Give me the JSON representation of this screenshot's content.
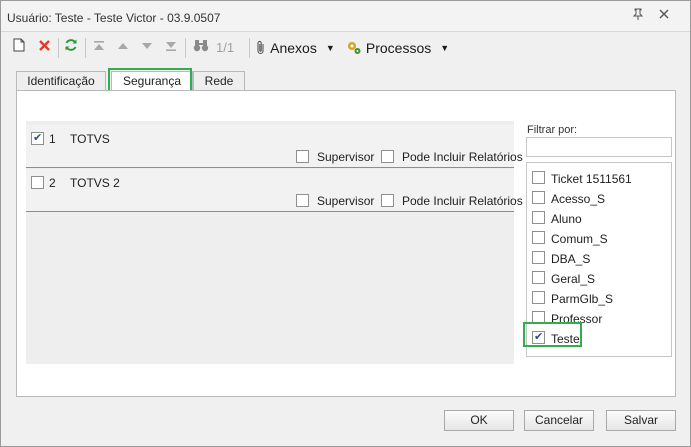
{
  "window": {
    "title": "Usuário: Teste - Teste Victor - 03.9.0507",
    "pin_icon": "pin-icon",
    "close_icon": "close-icon"
  },
  "toolbar": {
    "new_icon": "new-document-icon",
    "delete_icon": "delete-x-icon",
    "refresh_icon": "refresh-icon",
    "first_icon": "first-record-icon",
    "prev_icon": "previous-record-icon",
    "next_icon": "next-record-icon",
    "last_icon": "last-record-icon",
    "search_icon": "binoculars-icon",
    "pager": "1/1",
    "attachments_label": "Anexos",
    "processes_label": "Processos",
    "colors": {
      "delete": "#e23b2e",
      "refresh": "#2d9a3a"
    }
  },
  "tabs": [
    {
      "label": "Identificação",
      "active": false
    },
    {
      "label": "Segurança",
      "active": true
    },
    {
      "label": "Rede",
      "active": false
    }
  ],
  "companies": [
    {
      "number": "1",
      "name": "TOTVS",
      "checked": true,
      "supervisor_label": "Supervisor",
      "supervisor_checked": false,
      "reports_label": "Pode Incluir Relatórios",
      "reports_checked": false
    },
    {
      "number": "2",
      "name": "TOTVS 2",
      "checked": false,
      "supervisor_label": "Supervisor",
      "supervisor_checked": false,
      "reports_label": "Pode Incluir Relatórios",
      "reports_checked": false
    }
  ],
  "filter": {
    "label": "Filtrar por:",
    "value": ""
  },
  "groups": [
    {
      "label": "Ticket 1511561",
      "checked": false
    },
    {
      "label": "Acesso_S",
      "checked": false
    },
    {
      "label": "Aluno",
      "checked": false
    },
    {
      "label": "Comum_S",
      "checked": false
    },
    {
      "label": "DBA_S",
      "checked": false
    },
    {
      "label": "Geral_S",
      "checked": false
    },
    {
      "label": "ParmGlb_S",
      "checked": false
    },
    {
      "label": "Professor",
      "checked": false
    },
    {
      "label": "Teste",
      "checked": true
    }
  ],
  "buttons": {
    "ok": "OK",
    "cancel": "Cancelar",
    "save": "Salvar"
  },
  "highlight_color": "#2fae4d"
}
